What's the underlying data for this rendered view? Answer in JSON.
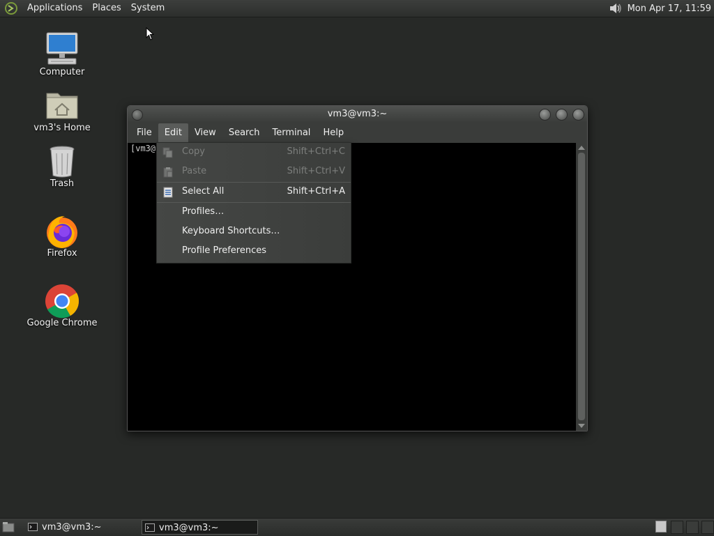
{
  "top_panel": {
    "menus": [
      "Applications",
      "Places",
      "System"
    ],
    "clock": "Mon Apr 17, 11:59",
    "icons": {
      "logo": "distro-logo-icon",
      "volume": "volume-icon"
    }
  },
  "desktop_icons": [
    {
      "label": "Computer",
      "icon": "computer-icon"
    },
    {
      "label": "vm3's Home",
      "icon": "home-folder-icon"
    },
    {
      "label": "Trash",
      "icon": "trash-icon"
    },
    {
      "label": "Firefox",
      "icon": "firefox-icon"
    },
    {
      "label": "Google Chrome",
      "icon": "chrome-icon"
    }
  ],
  "window": {
    "title": "vm3@vm3:~",
    "menus": [
      "File",
      "Edit",
      "View",
      "Search",
      "Terminal",
      "Help"
    ],
    "active_menu": "Edit",
    "prompt_text": "[vm3@"
  },
  "edit_menu": {
    "items": [
      {
        "label": "Copy",
        "accel": "Shift+Ctrl+C",
        "disabled": true,
        "icon": "copy-icon"
      },
      {
        "label": "Paste",
        "accel": "Shift+Ctrl+V",
        "disabled": true,
        "icon": "paste-icon"
      },
      {
        "label": "Select All",
        "accel": "Shift+Ctrl+A",
        "disabled": false,
        "icon": "select-all-icon"
      },
      {
        "label": "Profiles…",
        "accel": "",
        "disabled": false
      },
      {
        "label": "Keyboard Shortcuts…",
        "accel": "",
        "disabled": false
      },
      {
        "label": "Profile Preferences",
        "accel": "",
        "disabled": false
      }
    ]
  },
  "taskbar": {
    "tasks": [
      {
        "label": "vm3@vm3:~",
        "active": false
      },
      {
        "label": "vm3@vm3:~",
        "active": true
      }
    ],
    "workspace_count": 4,
    "active_workspace": 1
  },
  "colors": {
    "desktop_bg": "#272927",
    "panel_bg": "#343634",
    "menu_bg": "#414341",
    "terminal_bg": "#000000"
  }
}
